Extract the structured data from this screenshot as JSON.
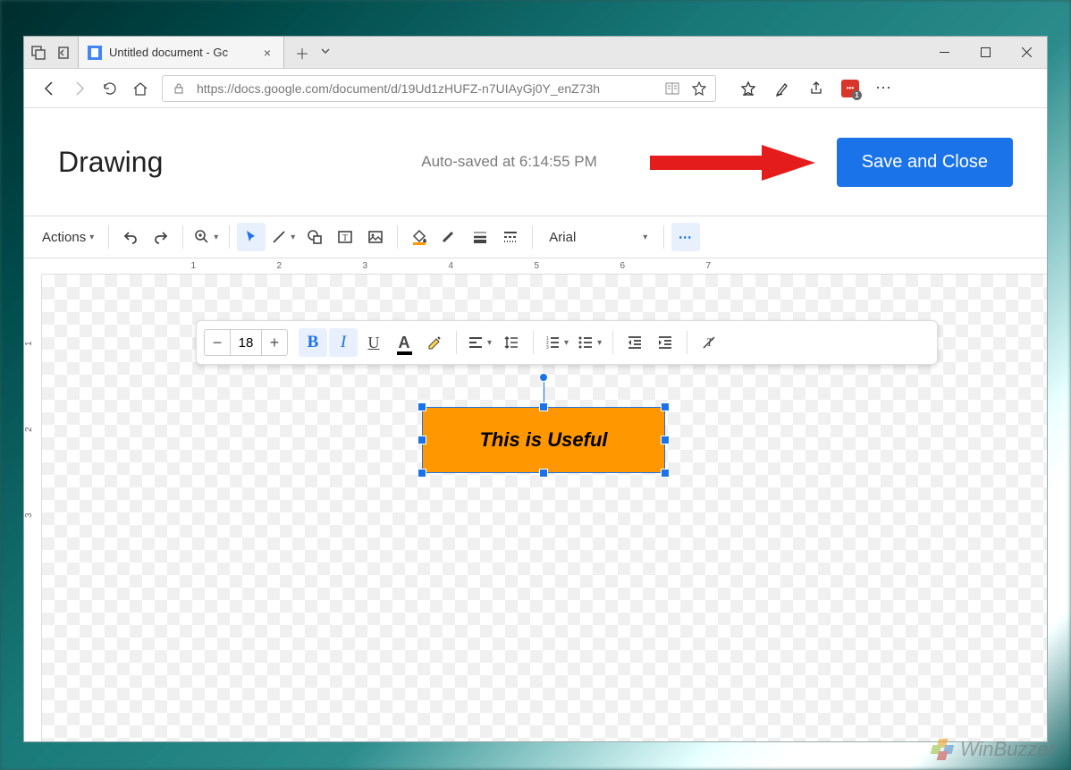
{
  "browser": {
    "tab_title": "Untitled document - Gc",
    "url_display": "https://docs.google.com/document/d/19Ud1zHUFZ-n7UIAyGj0Y_enZ73h"
  },
  "dialog": {
    "title": "Drawing",
    "autosave_status": "Auto-saved at 6:14:55 PM",
    "save_button_label": "Save and Close"
  },
  "toolbar": {
    "actions_label": "Actions",
    "font_name": "Arial",
    "font_size": "18"
  },
  "shape": {
    "text": "This is Useful",
    "fill_color": "#ff9800"
  },
  "watermark": {
    "text": "WinBuzzer"
  },
  "ext": {
    "count": "1"
  }
}
